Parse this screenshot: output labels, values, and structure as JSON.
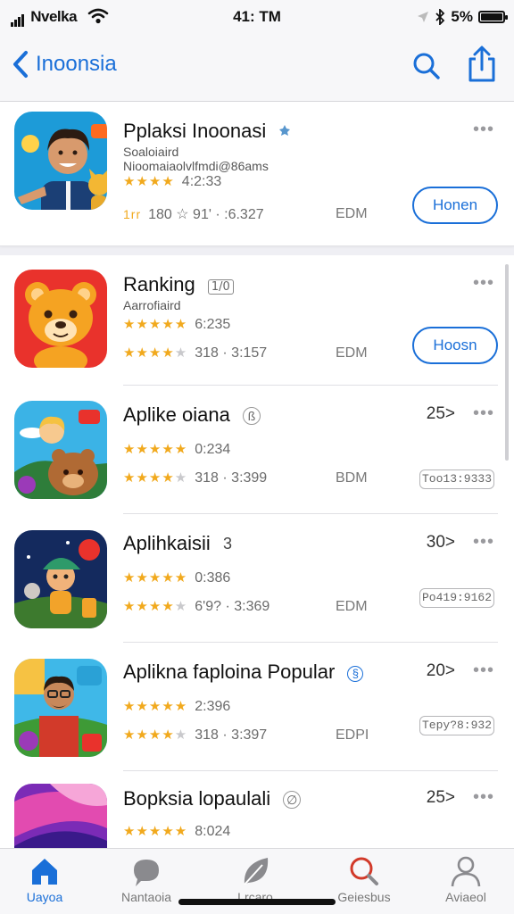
{
  "status_bar": {
    "carrier": "Nvelka",
    "time": "41: TM",
    "battery": "5%"
  },
  "nav": {
    "back_label": "Inoonsia",
    "icons": [
      "chevron-left-icon",
      "search-icon",
      "share-icon"
    ]
  },
  "featured": {
    "title": "Pplaksi Inoonasi",
    "subtitle1": "Soaloiaird",
    "subtitle2": "Nioomaiaolvlfmdi@86ams",
    "stars_line1": "★★★★",
    "rating1": "4:2:33",
    "stars_line2_prefix": "1rr",
    "stats": "180 ☆ 91' · :6.327",
    "edm": "EDM",
    "dots": "•••",
    "button": "Honen"
  },
  "apps": [
    {
      "title": "Ranking",
      "badge": "1/0",
      "subtitle": "Aarrofiaird",
      "rating1": "6:235",
      "rating2": "318 · 3:157",
      "edm": "EDM",
      "dots": "•••",
      "button": "Hoosn",
      "count": "",
      "pill": ""
    },
    {
      "title": "Aplike oiana",
      "badge": "ß",
      "subtitle": "",
      "rating1": "0:234",
      "rating2": "318 · 3:399",
      "edm": "BDM",
      "dots": "•••",
      "button": "",
      "count": "25>",
      "pill": "Too13:9333"
    },
    {
      "title": "Aplihkaisii",
      "badge": "3",
      "subtitle": "",
      "rating1": "0:386",
      "rating2": "6'9? · 3:369",
      "edm": "EDM",
      "dots": "•••",
      "button": "",
      "count": "30>",
      "pill": "Po419:9162"
    },
    {
      "title": "Aplikna faploina Popular",
      "badge": "§",
      "subtitle": "",
      "rating1": "2:396",
      "rating2": "318 · 3:397",
      "edm": "EDPI",
      "dots": "•••",
      "button": "",
      "count": "20>",
      "pill": "Tepy?8:932"
    },
    {
      "title": "Bopksia lopaulali",
      "badge": "∅",
      "subtitle": "",
      "rating1": "8:024",
      "rating2": "",
      "edm": "",
      "dots": "•••",
      "button": "",
      "count": "25>",
      "pill": ""
    }
  ],
  "tabs": [
    {
      "label": "Uayoa",
      "icon": "home-icon",
      "active": true
    },
    {
      "label": "Nantaoia",
      "icon": "chat-icon",
      "active": false
    },
    {
      "label": "Lrcaro",
      "icon": "leaf-icon",
      "active": false
    },
    {
      "label": "Geiesbus",
      "icon": "search-icon",
      "active": false
    },
    {
      "label": "Aviaeol",
      "icon": "person-icon",
      "active": false
    }
  ],
  "colors": {
    "accent": "#1a6fd8",
    "star": "#f1a91d",
    "background": "#efeff4"
  }
}
